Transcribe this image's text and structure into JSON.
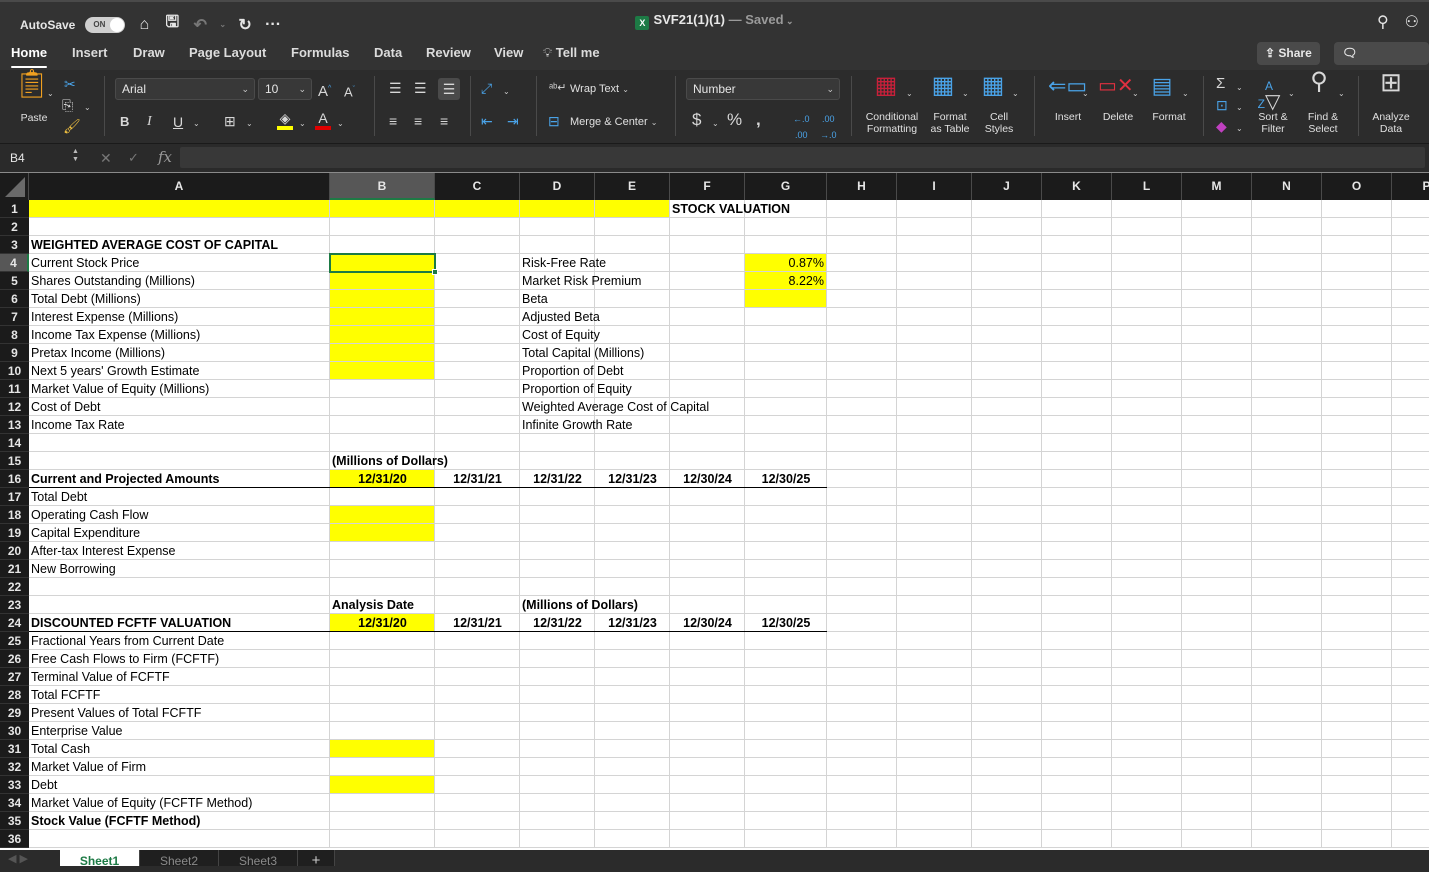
{
  "titlebar": {
    "autosave_label": "AutoSave",
    "autosave_state": "ON",
    "file_name": "SVF21(1)(1)",
    "save_status": "— Saved",
    "file_icon_letter": "X"
  },
  "tabs": [
    "Home",
    "Insert",
    "Draw",
    "Page Layout",
    "Formulas",
    "Data",
    "Review",
    "View",
    "Tell me"
  ],
  "active_tab": "Home",
  "share_label": "Share",
  "comments_label": "Comments",
  "ribbon": {
    "paste_label": "Paste",
    "font_name": "Arial",
    "font_size": "10",
    "wrap_text_label": "Wrap Text",
    "merge_center_label": "Merge & Center",
    "number_format": "Number",
    "conditional_formatting_label": "Conditional\nFormatting",
    "format_as_table_label": "Format\nas Table",
    "cell_styles_label": "Cell\nStyles",
    "insert_label": "Insert",
    "delete_label": "Delete",
    "format_label": "Format",
    "sort_filter_label": "Sort &\nFilter",
    "find_select_label": "Find &\nSelect",
    "analyze_data_label": "Analyze\nData",
    "fill_color": "#ffff00",
    "font_color": "#e00000"
  },
  "formula_bar": {
    "name_box": "B4",
    "fx_label": "fx",
    "formula": ""
  },
  "columns": [
    "A",
    "B",
    "C",
    "D",
    "E",
    "F",
    "G",
    "H",
    "I",
    "J",
    "K",
    "L",
    "M",
    "N",
    "O",
    "P"
  ],
  "selected_column": "B",
  "selected_row": 4,
  "rows": [
    "1",
    "2",
    "3",
    "4",
    "5",
    "6",
    "7",
    "8",
    "9",
    "10",
    "11",
    "12",
    "13",
    "14",
    "15",
    "16",
    "17",
    "18",
    "19",
    "20",
    "21",
    "22",
    "23",
    "24",
    "25",
    "26",
    "27",
    "28",
    "29",
    "30",
    "31",
    "32",
    "33",
    "34",
    "35",
    "36"
  ],
  "cells": {
    "F1": "STOCK VALUATION",
    "A3": "WEIGHTED AVERAGE COST OF CAPITAL",
    "A4": "Current Stock Price",
    "A5": "Shares Outstanding (Millions)",
    "A6": "Total Debt (Millions)",
    "A7": "Interest Expense (Millions)",
    "A8": "Income Tax Expense (Millions)",
    "A9": "Pretax Income (Millions)",
    "A10": "Next 5 years' Growth Estimate",
    "A11": "Market Value of Equity (Millions)",
    "A12": "Cost of Debt",
    "A13": "Income Tax Rate",
    "D4": "Risk-Free Rate",
    "D5": "Market Risk Premium",
    "D6": "Beta",
    "D7": "Adjusted Beta",
    "D8": "Cost of Equity",
    "D9": "Total Capital (Millions)",
    "D10": "Proportion of Debt",
    "D11": "Proportion of Equity",
    "D12": "Weighted Average Cost of Capital",
    "D13": "Infinite Growth Rate",
    "G4": "0.87%",
    "G5": "8.22%",
    "B15": "(Millions of Dollars)",
    "A16": "Current and Projected Amounts",
    "B16": "12/31/20",
    "C16": "12/31/21",
    "D16": "12/31/22",
    "E16": "12/31/23",
    "F16": "12/30/24",
    "G16": "12/30/25",
    "A17": "Total Debt",
    "A18": "Operating Cash Flow",
    "A19": "Capital Expenditure",
    "A20": "After-tax Interest Expense",
    "A21": "New Borrowing",
    "B23": "Analysis Date",
    "D23": "(Millions of Dollars)",
    "A24": "DISCOUNTED FCFTF VALUATION",
    "B24": "12/31/20",
    "C24": "12/31/21",
    "D24": "12/31/22",
    "E24": "12/31/23",
    "F24": "12/30/24",
    "G24": "12/30/25",
    "A25": "Fractional Years from Current Date",
    "A26": "Free Cash Flows to Firm (FCFTF)",
    "A27": "Terminal Value of FCFTF",
    "A28": "Total FCFTF",
    "A29": "Present Values of Total FCFTF",
    "A30": "Enterprise Value",
    "A31": "Total Cash",
    "A32": "Market Value of Firm",
    "A33": "Debt",
    "A34": "Market Value of Equity (FCFTF Method)",
    "A35": "Stock Value (FCFTF Method)"
  },
  "highlight_color": "#ffff00",
  "sheets": [
    "Sheet1",
    "Sheet2",
    "Sheet3"
  ],
  "active_sheet": "Sheet1",
  "add_sheet_label": "+"
}
